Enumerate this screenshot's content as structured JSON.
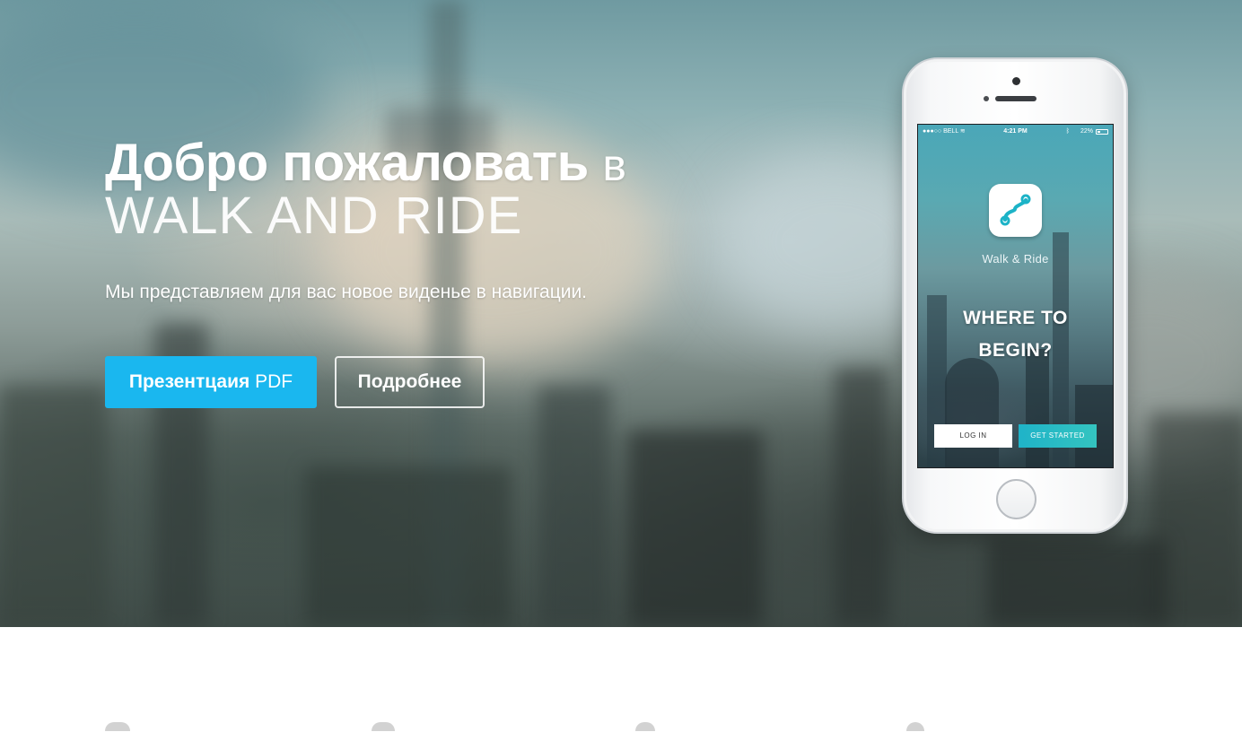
{
  "hero": {
    "title_bold": "Добро пожаловать",
    "title_light": "в",
    "title_brand": "WALK AND RIDE",
    "subtitle": "Мы представляем для вас новое виденье в навигации.",
    "btn_pdf_bold": "Презентцаия",
    "btn_pdf_light": "PDF",
    "btn_more": "Подробнее",
    "accent_color": "#1ab7ef"
  },
  "phone": {
    "status": {
      "carrier": "●●●○○ BELL",
      "time": "4:21 PM",
      "battery": "22%"
    },
    "app_icon": "walk-and-ride-route-icon",
    "app_name": "Walk & Ride",
    "headline_line1": "WHERE TO",
    "headline_line2": "BEGIN?",
    "btn_login": "LOG IN",
    "btn_start": "GET STARTED"
  }
}
